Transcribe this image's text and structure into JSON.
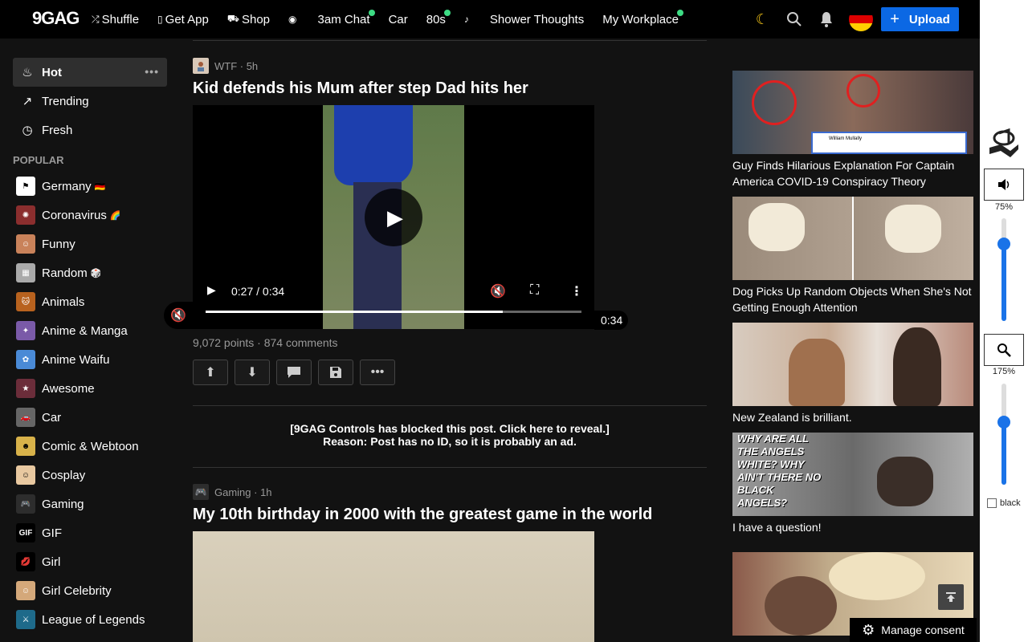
{
  "logo": "9GAG",
  "nav": [
    {
      "icon": "shuffle-icon",
      "glyph": "⤮",
      "label": "Shuffle",
      "dot": false
    },
    {
      "icon": "phone-icon",
      "glyph": "▯",
      "label": "Get App",
      "dot": false
    },
    {
      "icon": "cart-icon",
      "glyph": "⛟",
      "label": "Shop",
      "dot": false
    },
    {
      "icon": "emoji-icon",
      "glyph": "◉",
      "label": "",
      "dot": false
    },
    {
      "icon": "",
      "glyph": "",
      "label": "3am Chat",
      "dot": true
    },
    {
      "icon": "",
      "glyph": "",
      "label": "Car",
      "dot": false
    },
    {
      "icon": "",
      "glyph": "",
      "label": "80s",
      "dot": true
    },
    {
      "icon": "music-icon",
      "glyph": "♪",
      "label": "",
      "dot": false
    },
    {
      "icon": "",
      "glyph": "",
      "label": "Shower Thoughts",
      "dot": false
    },
    {
      "icon": "",
      "glyph": "",
      "label": "My Workplace",
      "dot": true
    }
  ],
  "header": {
    "upload_label": "Upload",
    "flag_colors": [
      "#000000",
      "#dd0000",
      "#ffce00"
    ]
  },
  "sidebar": {
    "main": [
      {
        "label": "Hot",
        "icon": "fire-icon",
        "glyph": "♨",
        "active": true
      },
      {
        "label": "Trending",
        "icon": "trending-icon",
        "glyph": "↗",
        "active": false
      },
      {
        "label": "Fresh",
        "icon": "clock-icon",
        "glyph": "◷",
        "active": false
      }
    ],
    "popular_label": "POPULAR",
    "sections": [
      {
        "label": "Germany",
        "suffix": "🇩🇪",
        "color": "#ffffff",
        "fg": "#000000",
        "glyph": "⚑"
      },
      {
        "label": "Coronavirus",
        "suffix": "🌈",
        "color": "#8b2e2e",
        "fg": "#ffffff",
        "glyph": "✺"
      },
      {
        "label": "Funny",
        "suffix": "",
        "color": "#c9825a",
        "fg": "#ffffff",
        "glyph": "☺"
      },
      {
        "label": "Random",
        "suffix": "🎲",
        "color": "#aaaaaa",
        "fg": "#ffffff",
        "glyph": "▦"
      },
      {
        "label": "Animals",
        "suffix": "",
        "color": "#b8621e",
        "fg": "#ffffff",
        "glyph": "🐱"
      },
      {
        "label": "Anime & Manga",
        "suffix": "",
        "color": "#7a5aa8",
        "fg": "#ffffff",
        "glyph": "✦"
      },
      {
        "label": "Anime Waifu",
        "suffix": "",
        "color": "#4a8ad6",
        "fg": "#ffffff",
        "glyph": "✿"
      },
      {
        "label": "Awesome",
        "suffix": "",
        "color": "#6b2d3a",
        "fg": "#ffffff",
        "glyph": "★"
      },
      {
        "label": "Car",
        "suffix": "",
        "color": "#666666",
        "fg": "#ffffff",
        "glyph": "🚗"
      },
      {
        "label": "Comic & Webtoon",
        "suffix": "",
        "color": "#d8b24a",
        "fg": "#000000",
        "glyph": "☻"
      },
      {
        "label": "Cosplay",
        "suffix": "",
        "color": "#e8c8a0",
        "fg": "#000000",
        "glyph": "☺"
      },
      {
        "label": "Gaming",
        "suffix": "",
        "color": "#2d2d2d",
        "fg": "#ffffff",
        "glyph": "🎮"
      },
      {
        "label": "GIF",
        "suffix": "",
        "color": "#000000",
        "fg": "#ffffff",
        "glyph": "GIF"
      },
      {
        "label": "Girl",
        "suffix": "",
        "color": "#000000",
        "fg": "#e02030",
        "glyph": "💋"
      },
      {
        "label": "Girl Celebrity",
        "suffix": "",
        "color": "#d4a87a",
        "fg": "#ffffff",
        "glyph": "☺"
      },
      {
        "label": "League of Legends",
        "suffix": "",
        "color": "#1e6a8a",
        "fg": "#ffffff",
        "glyph": "⚔"
      }
    ]
  },
  "post1": {
    "section": "WTF · 5h",
    "title": "Kid defends his Mum after step Dad hits her",
    "time": "0:27 / 0:34",
    "progress": 0.79,
    "duration": "0:34",
    "stats": "9,072 points · 874 comments"
  },
  "blocked": {
    "line1": "[9GAG Controls has blocked this post. Click here to reveal.]",
    "line2": "Reason: Post has no ID, so it is probably an ad."
  },
  "post2": {
    "section": "Gaming · 1h",
    "title": "My 10th birthday in 2000 with the greatest game in the world"
  },
  "featured": [
    {
      "caption": "Guy Finds Hilarious Explanation For Captain America COVID-19 Conspiracy Theory",
      "name_small": "William Mullally",
      "bg": "#6a5a4a"
    },
    {
      "caption": "Dog Picks Up Random Objects When She's Not Getting Enough Attention",
      "bg": "#9a8a7a"
    },
    {
      "caption": "New Zealand is brilliant.",
      "bg": "#c9ad96"
    },
    {
      "caption": "I have a question!",
      "img_text": "WHY ARE ALL THE ANGELS WHITE? WHY AIN'T THERE NO BLACK ANGELS?",
      "bg": "#888888"
    },
    {
      "caption": "",
      "bg": "#a89478"
    }
  ],
  "consent": "Manage consent",
  "extension": {
    "volume": "75%",
    "volume_level": 0.75,
    "zoom": "175%",
    "zoom_level": 0.62,
    "black_label": "black"
  }
}
